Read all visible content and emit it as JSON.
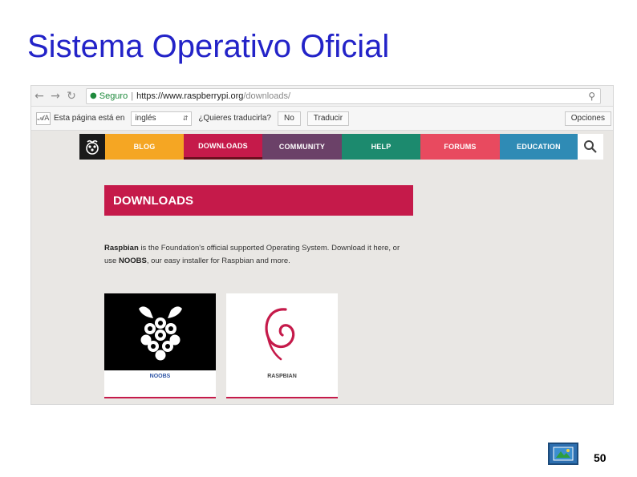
{
  "slide": {
    "title": "Sistema Operativo Oficial",
    "page_number": "50"
  },
  "browser": {
    "back_icon": "arrow-left-icon",
    "forward_icon": "arrow-right-icon",
    "reload_icon": "reload-icon",
    "secure_label": "Seguro",
    "separator": "|",
    "url_host": "https://www.raspberrypi.org",
    "url_path": "/downloads/",
    "zoom_icon": "search-icon"
  },
  "translate_bar": {
    "intro": "Esta página está en",
    "language": "inglés",
    "question": "¿Quieres traducirla?",
    "no_label": "No",
    "translate_label": "Traducir",
    "options_label": "Opciones"
  },
  "site_nav": {
    "tabs": [
      {
        "label": "BLOG",
        "color": "#f5a623"
      },
      {
        "label": "DOWNLOADS",
        "color": "#c51a4a"
      },
      {
        "label": "COMMUNITY",
        "color": "#6b4168"
      },
      {
        "label": "HELP",
        "color": "#1c8a6e"
      },
      {
        "label": "FORUMS",
        "color": "#e84a5f"
      },
      {
        "label": "EDUCATION",
        "color": "#2f8bb5"
      }
    ]
  },
  "main": {
    "heading": "DOWNLOADS",
    "intro_bold_1": "Raspbian",
    "intro_text_1": " is the Foundation's official supported Operating System. Download it here, or use ",
    "intro_bold_2": "NOOBS",
    "intro_text_2": ", our easy installer for Raspbian and more.",
    "cards": [
      {
        "label": "NOOBS"
      },
      {
        "label": "RASPBIAN"
      }
    ]
  },
  "colors": {
    "accent": "#c51a4a",
    "title": "#2323c8"
  }
}
